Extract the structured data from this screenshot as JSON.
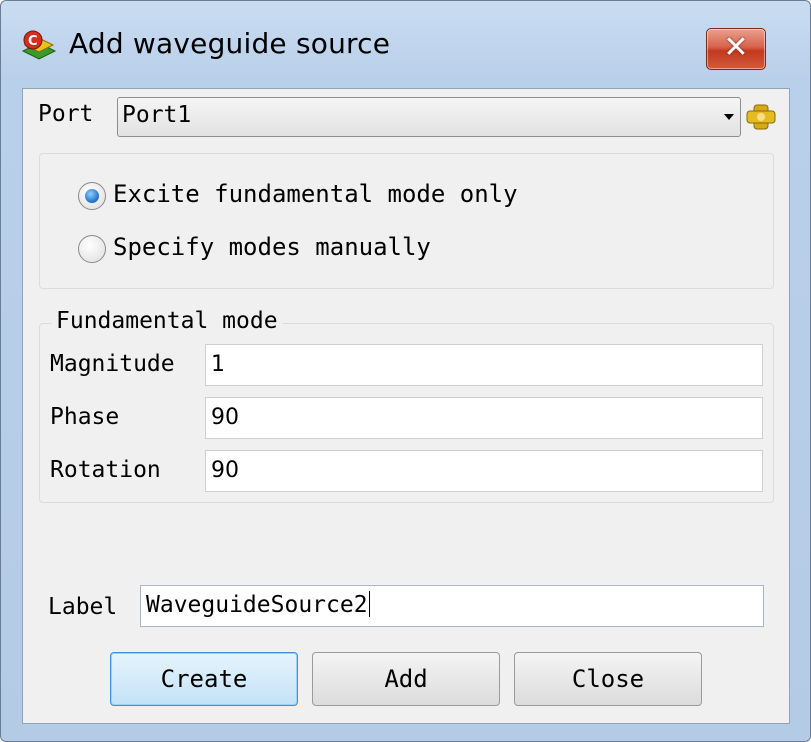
{
  "window": {
    "title": "Add waveguide source",
    "close_label": "✕",
    "app_icon": "cst-app-icon"
  },
  "port": {
    "label": "Port",
    "selected": "Port1",
    "picker_icon": "pick-port-icon"
  },
  "excitation": {
    "options": [
      {
        "label": "Excite fundamental mode only",
        "checked": true
      },
      {
        "label": "Specify modes manually",
        "checked": false
      }
    ]
  },
  "fundamental_mode": {
    "title": "Fundamental mode",
    "fields": [
      {
        "label": "Magnitude",
        "value": "1"
      },
      {
        "label": "Phase",
        "value": "90"
      },
      {
        "label": "Rotation",
        "value": "90"
      }
    ]
  },
  "label_field": {
    "label": "Label",
    "value": "WaveguideSource2"
  },
  "buttons": {
    "create": "Create",
    "add": "Add",
    "close": "Close"
  },
  "colors": {
    "title_bar": "#c9dcf1",
    "dialog_bg": "#f0f0f0",
    "close_button": "#c2391e",
    "default_button_border": "#3c8fd8",
    "radio_checked": "#1c6fc5"
  }
}
